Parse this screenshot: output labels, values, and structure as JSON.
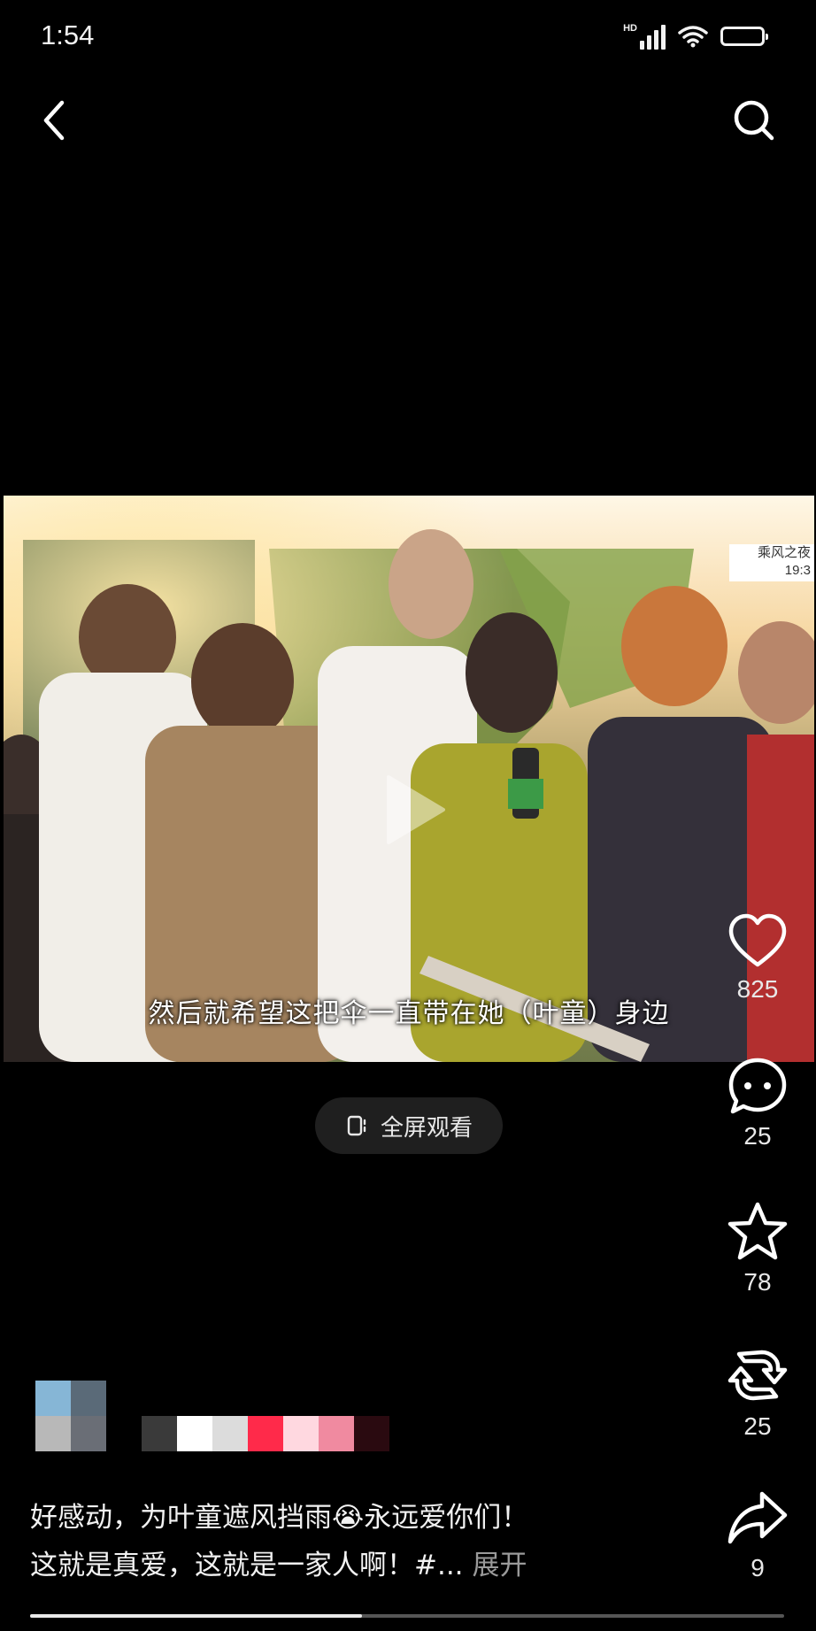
{
  "status_bar": {
    "time": "1:54",
    "network_label": "HD",
    "icons": [
      "signal-icon",
      "wifi-icon",
      "battery-icon"
    ]
  },
  "nav": {
    "back_icon": "chevron-left-icon",
    "search_icon": "search-icon"
  },
  "video": {
    "subtitle": "然后就希望这把伞一直带在她（叶童）身边",
    "play_icon": "play-icon",
    "logo_text": "乘风之夜 19:3"
  },
  "fullscreen_button": {
    "label": "全屏观看",
    "icon": "fullscreen-icon"
  },
  "actions": [
    {
      "name": "like",
      "icon": "heart-icon",
      "count": "825"
    },
    {
      "name": "comment",
      "icon": "comment-icon",
      "count": "25"
    },
    {
      "name": "favorite",
      "icon": "star-icon",
      "count": "78"
    },
    {
      "name": "repost",
      "icon": "repost-icon",
      "count": "25"
    },
    {
      "name": "share",
      "icon": "share-icon",
      "count": "9"
    }
  ],
  "caption": {
    "line1": "好感动，为叶童遮风挡雨😭永远爱你们！",
    "line2": "这就是真爱，这就是一家人啊！#...",
    "expand": "展开"
  },
  "progress": {
    "played_fraction": 0.44
  },
  "colors": {
    "background": "#000000",
    "text": "#f2f2f2",
    "muted": "#9a9a9a",
    "pill": "#1f1f1f"
  }
}
